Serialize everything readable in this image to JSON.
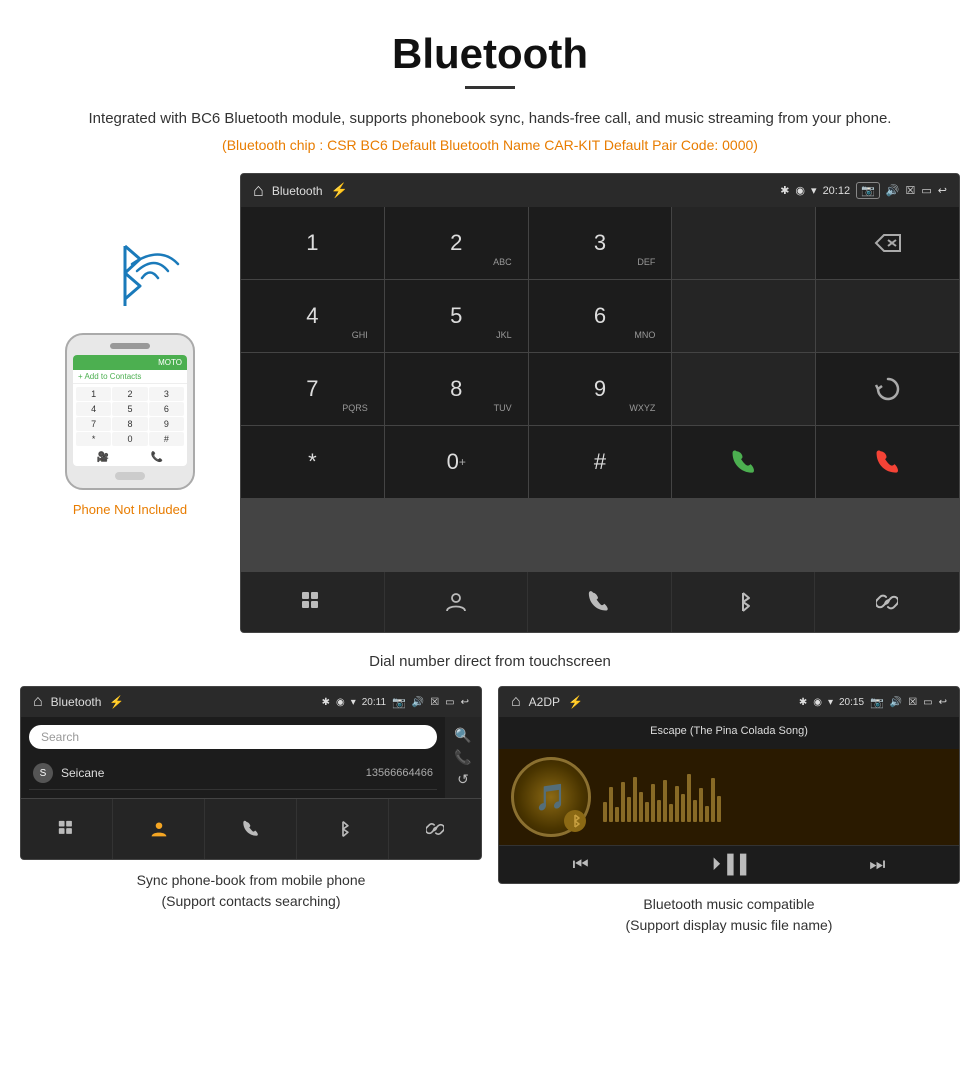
{
  "header": {
    "title": "Bluetooth",
    "underline": true,
    "description": "Integrated with BC6 Bluetooth module, supports phonebook sync, hands-free call, and music streaming from your phone.",
    "specs": "(Bluetooth chip : CSR BC6    Default Bluetooth Name CAR-KIT    Default Pair Code: 0000)"
  },
  "phone_sidebar": {
    "not_included_label": "Phone Not Included"
  },
  "car_screen_dial": {
    "statusbar": {
      "title": "Bluetooth",
      "time": "20:12"
    },
    "dialpad": [
      {
        "number": "1",
        "sub": ""
      },
      {
        "number": "2",
        "sub": "ABC"
      },
      {
        "number": "3",
        "sub": "DEF"
      },
      {
        "number": "",
        "sub": ""
      },
      {
        "number": "⌫",
        "sub": ""
      },
      {
        "number": "4",
        "sub": "GHI"
      },
      {
        "number": "5",
        "sub": "JKL"
      },
      {
        "number": "6",
        "sub": "MNO"
      },
      {
        "number": "",
        "sub": ""
      },
      {
        "number": "",
        "sub": ""
      },
      {
        "number": "7",
        "sub": "PQRS"
      },
      {
        "number": "8",
        "sub": "TUV"
      },
      {
        "number": "9",
        "sub": "WXYZ"
      },
      {
        "number": "",
        "sub": ""
      },
      {
        "number": "↺",
        "sub": ""
      },
      {
        "number": "*",
        "sub": ""
      },
      {
        "number": "0",
        "sub": "+"
      },
      {
        "number": "#",
        "sub": ""
      },
      {
        "number": "📞",
        "sub": ""
      },
      {
        "number": "📵",
        "sub": ""
      }
    ],
    "bottom_icons": [
      "⊞",
      "👤",
      "📞",
      "✱",
      "🔗"
    ]
  },
  "main_caption": "Dial number direct from touchscreen",
  "bottom_left": {
    "statusbar_title": "Bluetooth",
    "statusbar_time": "20:11",
    "search_placeholder": "Search",
    "contact": {
      "letter": "S",
      "name": "Seicane",
      "phone": "13566664466"
    },
    "caption_line1": "Sync phone-book from mobile phone",
    "caption_line2": "(Support contacts searching)"
  },
  "bottom_right": {
    "statusbar_title": "A2DP",
    "statusbar_time": "20:15",
    "song_title": "Escape (The Pina Colada Song)",
    "caption_line1": "Bluetooth music compatible",
    "caption_line2": "(Support display music file name)"
  }
}
